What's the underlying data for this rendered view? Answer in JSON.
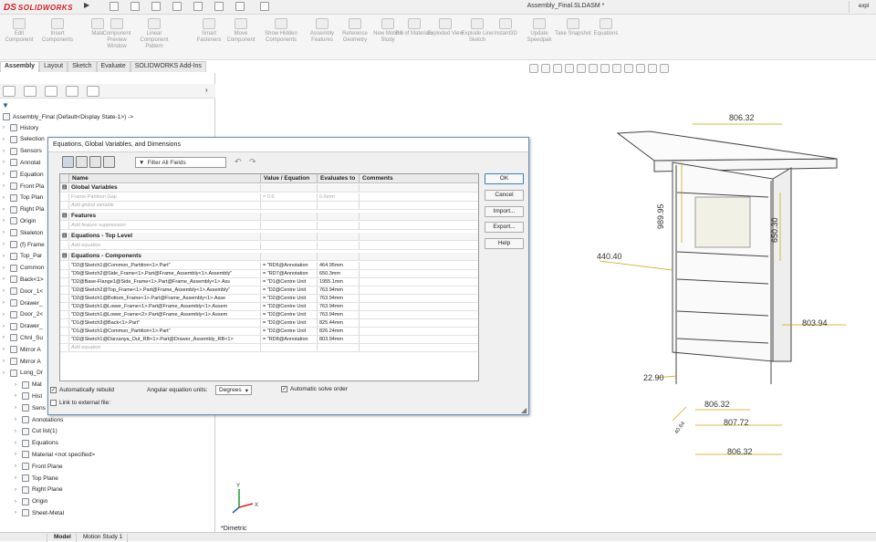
{
  "app": {
    "brand_ds": "DS",
    "brand_name": "SOLIDWORKS",
    "document_title": "Assembly_Final.SLDASM *",
    "corner_text": "expl"
  },
  "commands": [
    {
      "label": "Edit Component"
    },
    {
      "label": "Insert Components"
    },
    {
      "label": "Mate"
    },
    {
      "label": "Component Preview Window"
    },
    {
      "label": "Linear Component Pattern"
    },
    {
      "label": "Smart Fasteners"
    },
    {
      "label": "Move Component"
    },
    {
      "label": "Show Hidden Components"
    },
    {
      "label": "Assembly Features"
    },
    {
      "label": "Reference Geometry"
    },
    {
      "label": "New Motion Study"
    },
    {
      "label": "Bill of Materials"
    },
    {
      "label": "Exploded View"
    },
    {
      "label": "Explode Line Sketch"
    },
    {
      "label": "Instant3D"
    },
    {
      "label": "Update Speedpak"
    },
    {
      "label": "Take Snapshot"
    },
    {
      "label": "Equations"
    }
  ],
  "tabs": [
    "Assembly",
    "Layout",
    "Sketch",
    "Evaluate",
    "SOLIDWORKS Add-Ins"
  ],
  "tree": {
    "root": "Assembly_Final (Default<Display State-1>) ->",
    "items": [
      "History",
      "Selection",
      "Sensors",
      "Annotat",
      "Equation",
      "Front Pla",
      "Top Plan",
      "Right Pla",
      "Origin",
      "Skeleton",
      "(f) Frame",
      "Top_Par",
      "Common",
      "Back<1>",
      "Door_1<",
      "Drawer_",
      "Door_2<",
      "Drawer_",
      "Chnl_Su",
      "Mirror A",
      "Mirror A",
      "Long_Dr",
      "Mat",
      "Hist",
      "Sens",
      "Annotations",
      "Cut list(1)",
      "Equations",
      "Material <not specified>",
      "Front Plane",
      "Top Plane",
      "Right Plane",
      "Origin",
      "Sheet-Metal"
    ]
  },
  "bottom_tabs": [
    "Model",
    "Motion Study 1"
  ],
  "view": {
    "name": "*Dimetric"
  },
  "model_dims": [
    "806.32",
    "989.95",
    "650.30",
    "440.40",
    "803.94",
    "22.90",
    "806.32",
    "807.72",
    "806.32",
    "40.64"
  ],
  "dialog": {
    "title": "Equations, Global Variables, and Dimensions",
    "filter_placeholder": "Filter All Fields",
    "columns": [
      "Name",
      "Value / Equation",
      "Evaluates to",
      "Comments"
    ],
    "sections": {
      "global": "Global Variables",
      "features": "Features",
      "top": "Equations - Top Level",
      "components": "Equations - Components"
    },
    "global_row": {
      "name": "Frame-Partition Gap",
      "value": "= 0.6",
      "eval": "0.6mm"
    },
    "add_global": "Add global variable",
    "add_feature": "Add feature suppression",
    "add_equation": "Add equation",
    "add_equation2": "Add equation",
    "rows": [
      {
        "name": "\"D2@Sketch1@Common_Partition<1>.Part\"",
        "value": "= \"RD6@Annotation",
        "eval": "464.95mm"
      },
      {
        "name": "\"D9@Sketch2@Side_Frame<1>.Part@Frame_Assembly<1>.Assembly\"",
        "value": "= \"RD7@Annotation",
        "eval": "650.3mm"
      },
      {
        "name": "\"D2@Base-Flange1@Side_Frame<1>.Part@Frame_Assembly<1>.Ass",
        "value": "= \"D1@Centre Unit",
        "eval": "1955.1mm"
      },
      {
        "name": "\"D2@Sketch2@Top_Frame<1>.Part@Frame_Assembly<1>.Assembly\"",
        "value": "= \"D2@Centre Unit",
        "eval": "763.94mm"
      },
      {
        "name": "\"D2@Sketch1@Bottom_Frame<1>.Part@Frame_Assembly<1>.Asse",
        "value": "= \"D2@Centre Unit",
        "eval": "763.94mm"
      },
      {
        "name": "\"D2@Sketch1@Lower_Frame<1>.Part@Frame_Assembly<1>.Assem",
        "value": "= \"D2@Centre Unit",
        "eval": "763.94mm"
      },
      {
        "name": "\"D2@Sketch1@Lower_Frame<2>.Part@Frame_Assembly<1>.Assem",
        "value": "= \"D2@Centre Unit",
        "eval": "763.94mm"
      },
      {
        "name": "\"D1@Sketch3@Back<1>.Part\"",
        "value": "= \"D2@Centre Unit",
        "eval": "825.44mm"
      },
      {
        "name": "\"D1@Sketch1@Common_Partition<1>.Part\"",
        "value": "= \"D2@Centre Unit",
        "eval": "826.24mm"
      },
      {
        "name": "\"D2@Sketch1@Darzanya_Out_RB<1>.Part@Drawer_Assembly_RB<1>",
        "value": "= \"RD8@Annotation",
        "eval": "803.94mm"
      }
    ],
    "buttons": {
      "ok": "OK",
      "cancel": "Cancel",
      "import": "Import...",
      "export": "Export...",
      "help": "Help"
    },
    "auto_rebuild": "Automatically rebuild",
    "angular_label": "Angular equation units:",
    "angular_value": "Degrees",
    "auto_solve": "Automatic solve order",
    "link_file": "Link to external file:"
  }
}
